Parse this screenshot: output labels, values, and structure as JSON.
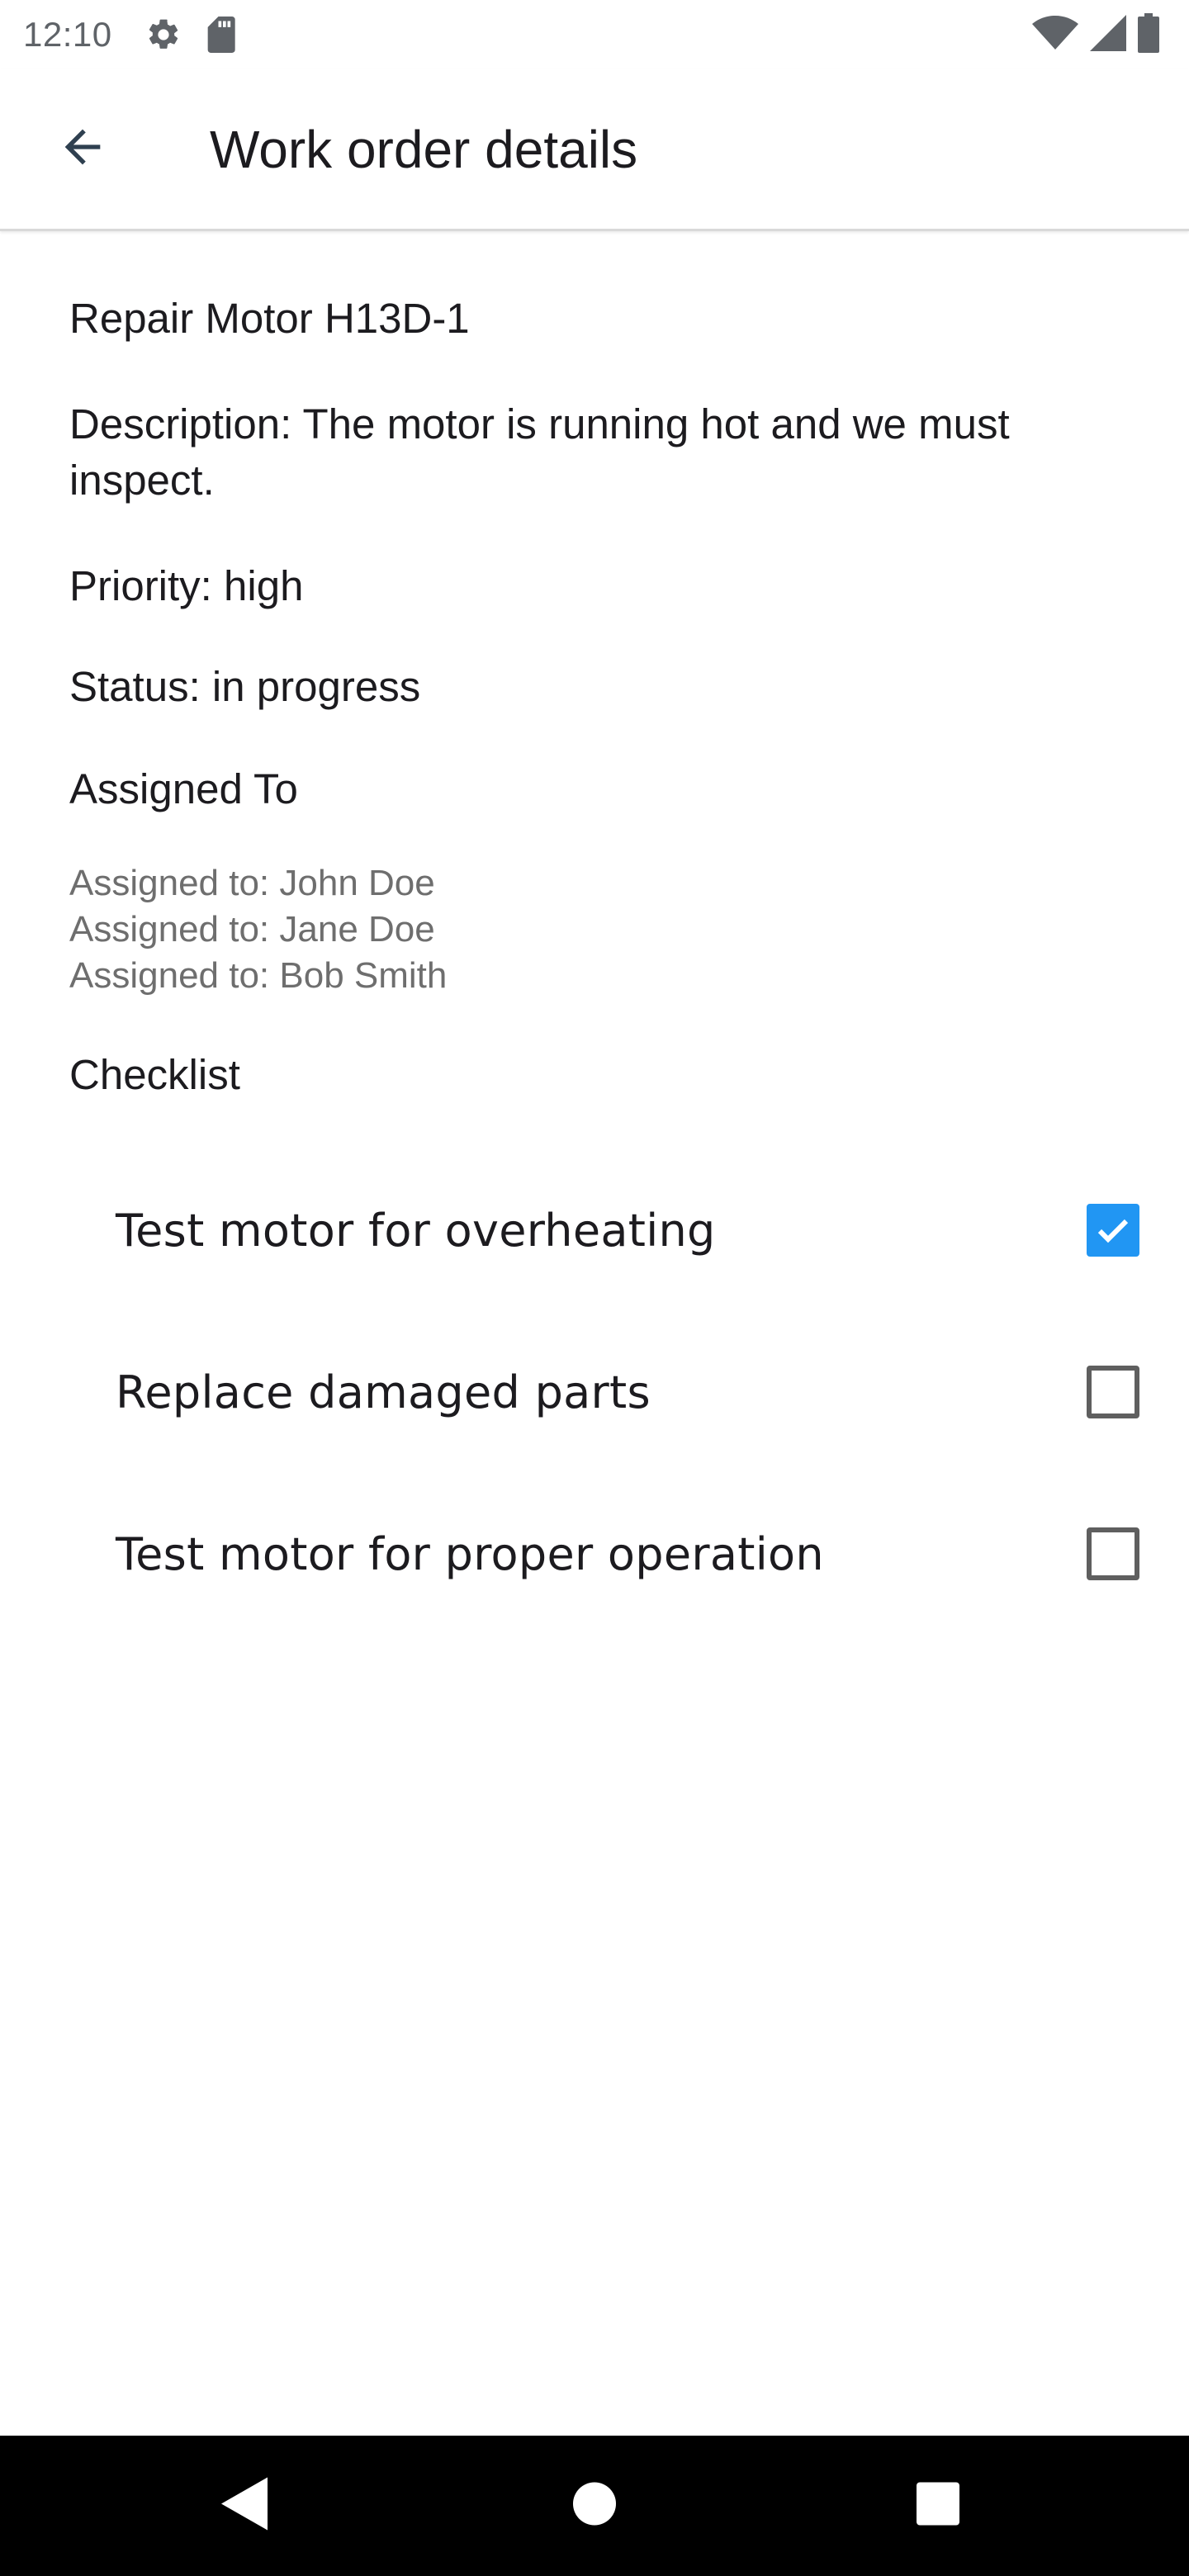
{
  "status_bar": {
    "time": "12:10",
    "icons": [
      "settings-icon",
      "sd-card-icon",
      "wifi-icon",
      "signal-icon",
      "battery-icon"
    ]
  },
  "app_bar": {
    "title": "Work order details",
    "back_icon": "arrow-back-icon"
  },
  "work_order": {
    "title": "Repair Motor H13D-1",
    "description": "Description: The motor is running hot and we must inspect.",
    "priority": "Priority: high",
    "status": "Status: in progress",
    "assigned_heading": "Assigned To",
    "assignees": [
      "Assigned to: John Doe",
      "Assigned to: Jane Doe",
      "Assigned to: Bob Smith"
    ],
    "checklist_heading": "Checklist",
    "checklist": [
      {
        "label": "Test motor for overheating",
        "checked": true
      },
      {
        "label": "Replace damaged parts",
        "checked": false
      },
      {
        "label": "Test motor for proper operation",
        "checked": false
      }
    ]
  },
  "nav_bar": {
    "icons": [
      "nav-back-icon",
      "nav-home-icon",
      "nav-recents-icon"
    ]
  },
  "colors": {
    "accent": "#2196f3",
    "text_primary": "#1c1b1f",
    "text_secondary": "#6e6e6e",
    "nav_background": "#000000"
  }
}
